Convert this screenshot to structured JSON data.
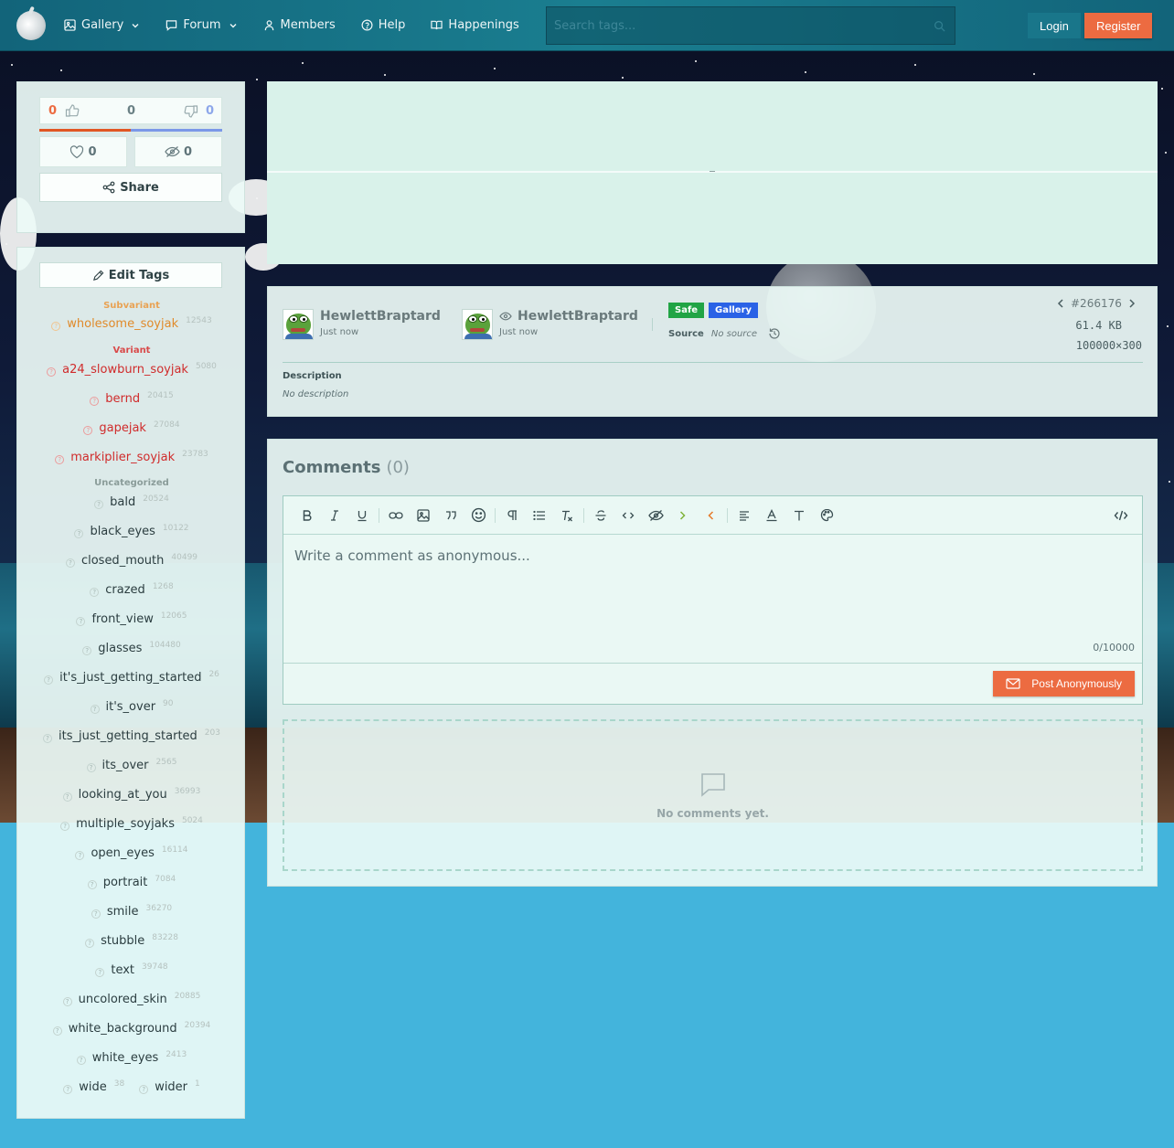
{
  "nav": {
    "items": [
      {
        "label": "Gallery",
        "icon": "image-icon",
        "dropdown": true
      },
      {
        "label": "Forum",
        "icon": "chat-icon",
        "dropdown": true
      },
      {
        "label": "Members",
        "icon": "user-icon",
        "dropdown": false
      },
      {
        "label": "Help",
        "icon": "help-circle-icon",
        "dropdown": false
      },
      {
        "label": "Happenings",
        "icon": "book-open-icon",
        "dropdown": false
      }
    ],
    "search_placeholder": "Search tags...",
    "login": "Login",
    "register": "Register"
  },
  "votes": {
    "upvotes": "0",
    "score": "0",
    "downvotes": "0",
    "favorites": "0",
    "hidden": "0",
    "share": "Share"
  },
  "tags": {
    "edit_label": "Edit Tags",
    "subvariant_label": "Subvariant",
    "variant_label": "Variant",
    "uncategorized_label": "Uncategorized",
    "subvariant": [
      {
        "name": "wholesome_soyjak",
        "count": "12543"
      }
    ],
    "variant": [
      {
        "name": "a24_slowburn_soyjak",
        "count": "5080"
      },
      {
        "name": "bernd",
        "count": "20415"
      },
      {
        "name": "gapejak",
        "count": "27084"
      },
      {
        "name": "markiplier_soyjak",
        "count": "23783"
      }
    ],
    "uncategorized": [
      {
        "name": "bald",
        "count": "20524"
      },
      {
        "name": "black_eyes",
        "count": "10122"
      },
      {
        "name": "closed_mouth",
        "count": "40499"
      },
      {
        "name": "crazed",
        "count": "1268"
      },
      {
        "name": "front_view",
        "count": "12065"
      },
      {
        "name": "glasses",
        "count": "104480"
      },
      {
        "name": "it's_just_getting_started",
        "count": "26"
      },
      {
        "name": "it's_over",
        "count": "90"
      },
      {
        "name": "its_just_getting_started",
        "count": "203"
      },
      {
        "name": "its_over",
        "count": "2565"
      },
      {
        "name": "looking_at_you",
        "count": "36993"
      },
      {
        "name": "multiple_soyjaks",
        "count": "5024"
      },
      {
        "name": "open_eyes",
        "count": "16114"
      },
      {
        "name": "portrait",
        "count": "7084"
      },
      {
        "name": "smile",
        "count": "36270"
      },
      {
        "name": "stubble",
        "count": "83228"
      },
      {
        "name": "text",
        "count": "39748"
      },
      {
        "name": "uncolored_skin",
        "count": "20885"
      },
      {
        "name": "white_background",
        "count": "20394"
      },
      {
        "name": "white_eyes",
        "count": "2413"
      },
      {
        "name": "wide",
        "count": "38"
      },
      {
        "name": "wider",
        "count": "1"
      }
    ]
  },
  "post": {
    "uploader": {
      "name": "HewlettBraptard",
      "time": "Just now"
    },
    "approver": {
      "name": "HewlettBraptard",
      "time": "Just now"
    },
    "rating": "Safe",
    "category": "Gallery",
    "source_label": "Source",
    "source_value": "No source",
    "id": "#266176",
    "file_size": "61.4 KB",
    "dimensions": "100000×300",
    "description_label": "Description",
    "description_value": "No description"
  },
  "comments": {
    "title": "Comments",
    "count": "(0)",
    "placeholder": "Write a comment as anonymous...",
    "char_count": "0/10000",
    "post_button": "Post Anonymously",
    "empty_text": "No comments yet."
  },
  "colors": {
    "accent": "#ec6b41",
    "nav_bg": "#1a7e90",
    "safe": "#21a445",
    "gallery": "#2a62e6"
  }
}
